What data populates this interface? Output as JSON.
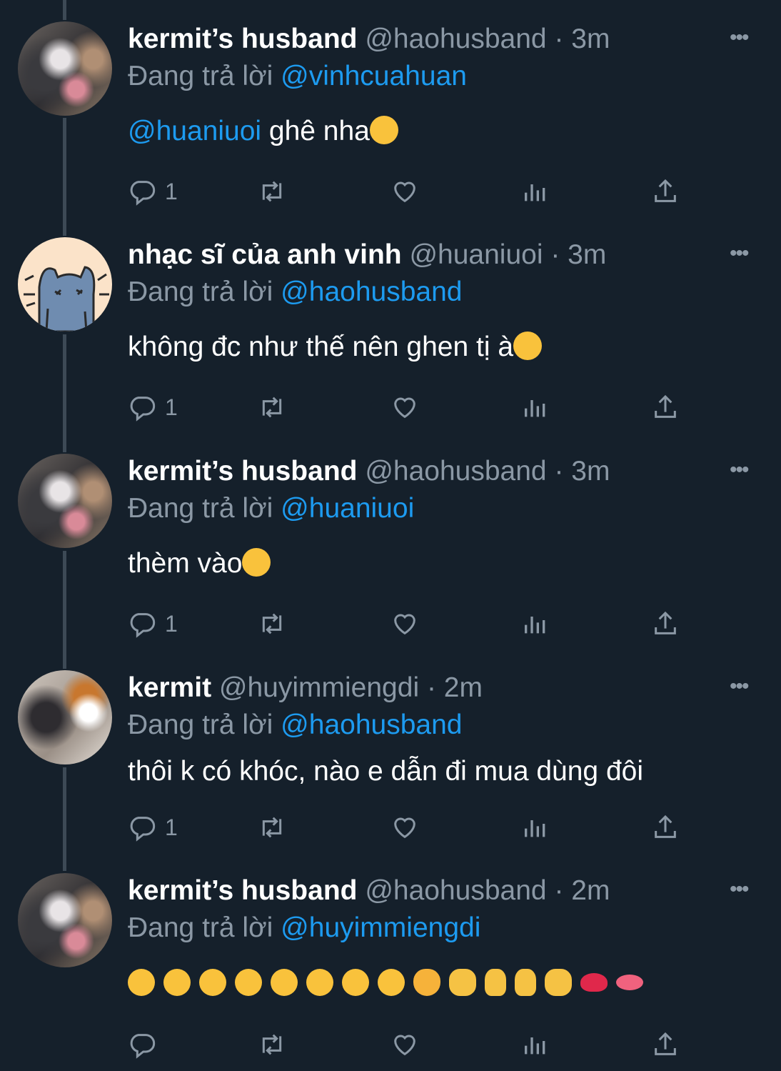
{
  "tweets": [
    {
      "display_name": "kermit’s husband",
      "handle": "@haohusband",
      "time": "· 3m",
      "reply_label": "Đang trả lời",
      "reply_to": "@vinhcuahuan",
      "mention": "@huaniuoi",
      "text": " ghê nha",
      "text_emoji": "relieved-face",
      "reply_count": "1",
      "avatar": "cat-avatar-haohusband"
    },
    {
      "display_name": "nhạc sĩ của anh vinh",
      "handle": "@huaniuoi",
      "time": "· 3m",
      "reply_label": "Đang trả lời",
      "reply_to": "@haohusband",
      "text": "không đc như thế nên ghen tị à",
      "text_emoji": "smirking-face",
      "reply_count": "1",
      "avatar": "cartoon-cat-avatar"
    },
    {
      "display_name": "kermit’s husband",
      "handle": "@haohusband",
      "time": "· 3m",
      "reply_label": "Đang trả lời",
      "reply_to": "@huaniuoi",
      "text": "thèm vào",
      "text_emoji": "face-with-steam",
      "reply_count": "1",
      "avatar": "cat-avatar-haohusband"
    },
    {
      "display_name": "kermit",
      "handle": "@huyimmiengdi",
      "time": "· 2m",
      "reply_label": "Đang trả lời",
      "reply_to": "@haohusband",
      "text": "thôi k có khóc, nào e dẫn đi mua dùng đôi",
      "reply_count": "1",
      "avatar": "calico-cat-avatar"
    },
    {
      "display_name": "kermit’s husband",
      "handle": "@haohusband",
      "time": "· 2m",
      "reply_label": "Đang trả lời",
      "reply_to": "@huyimmiengdi",
      "emoji_row": [
        "partying-face",
        "star-struck",
        "smiling-face-with-hearts",
        "kissing-face-closed-eyes",
        "heart-eyes",
        "kissing-face",
        "face-with-hand-over-mouth",
        "hugging-face",
        "heart-eyes-cat",
        "heart-hands",
        "crossed-fingers",
        "crossed-fingers",
        "pinching-hand",
        "kiss-mark",
        "lips"
      ],
      "reply_count": "",
      "avatar": "cat-avatar-haohusband"
    }
  ],
  "icons": {
    "reply": "reply-icon",
    "retweet": "retweet-icon",
    "like": "heart-icon",
    "views": "views-icon",
    "share": "share-icon",
    "more": "more-icon"
  },
  "colors": {
    "background": "#15202b",
    "secondary_text": "#8b98a5",
    "mention": "#1d9bf0",
    "thread_line": "#3d4a56"
  }
}
